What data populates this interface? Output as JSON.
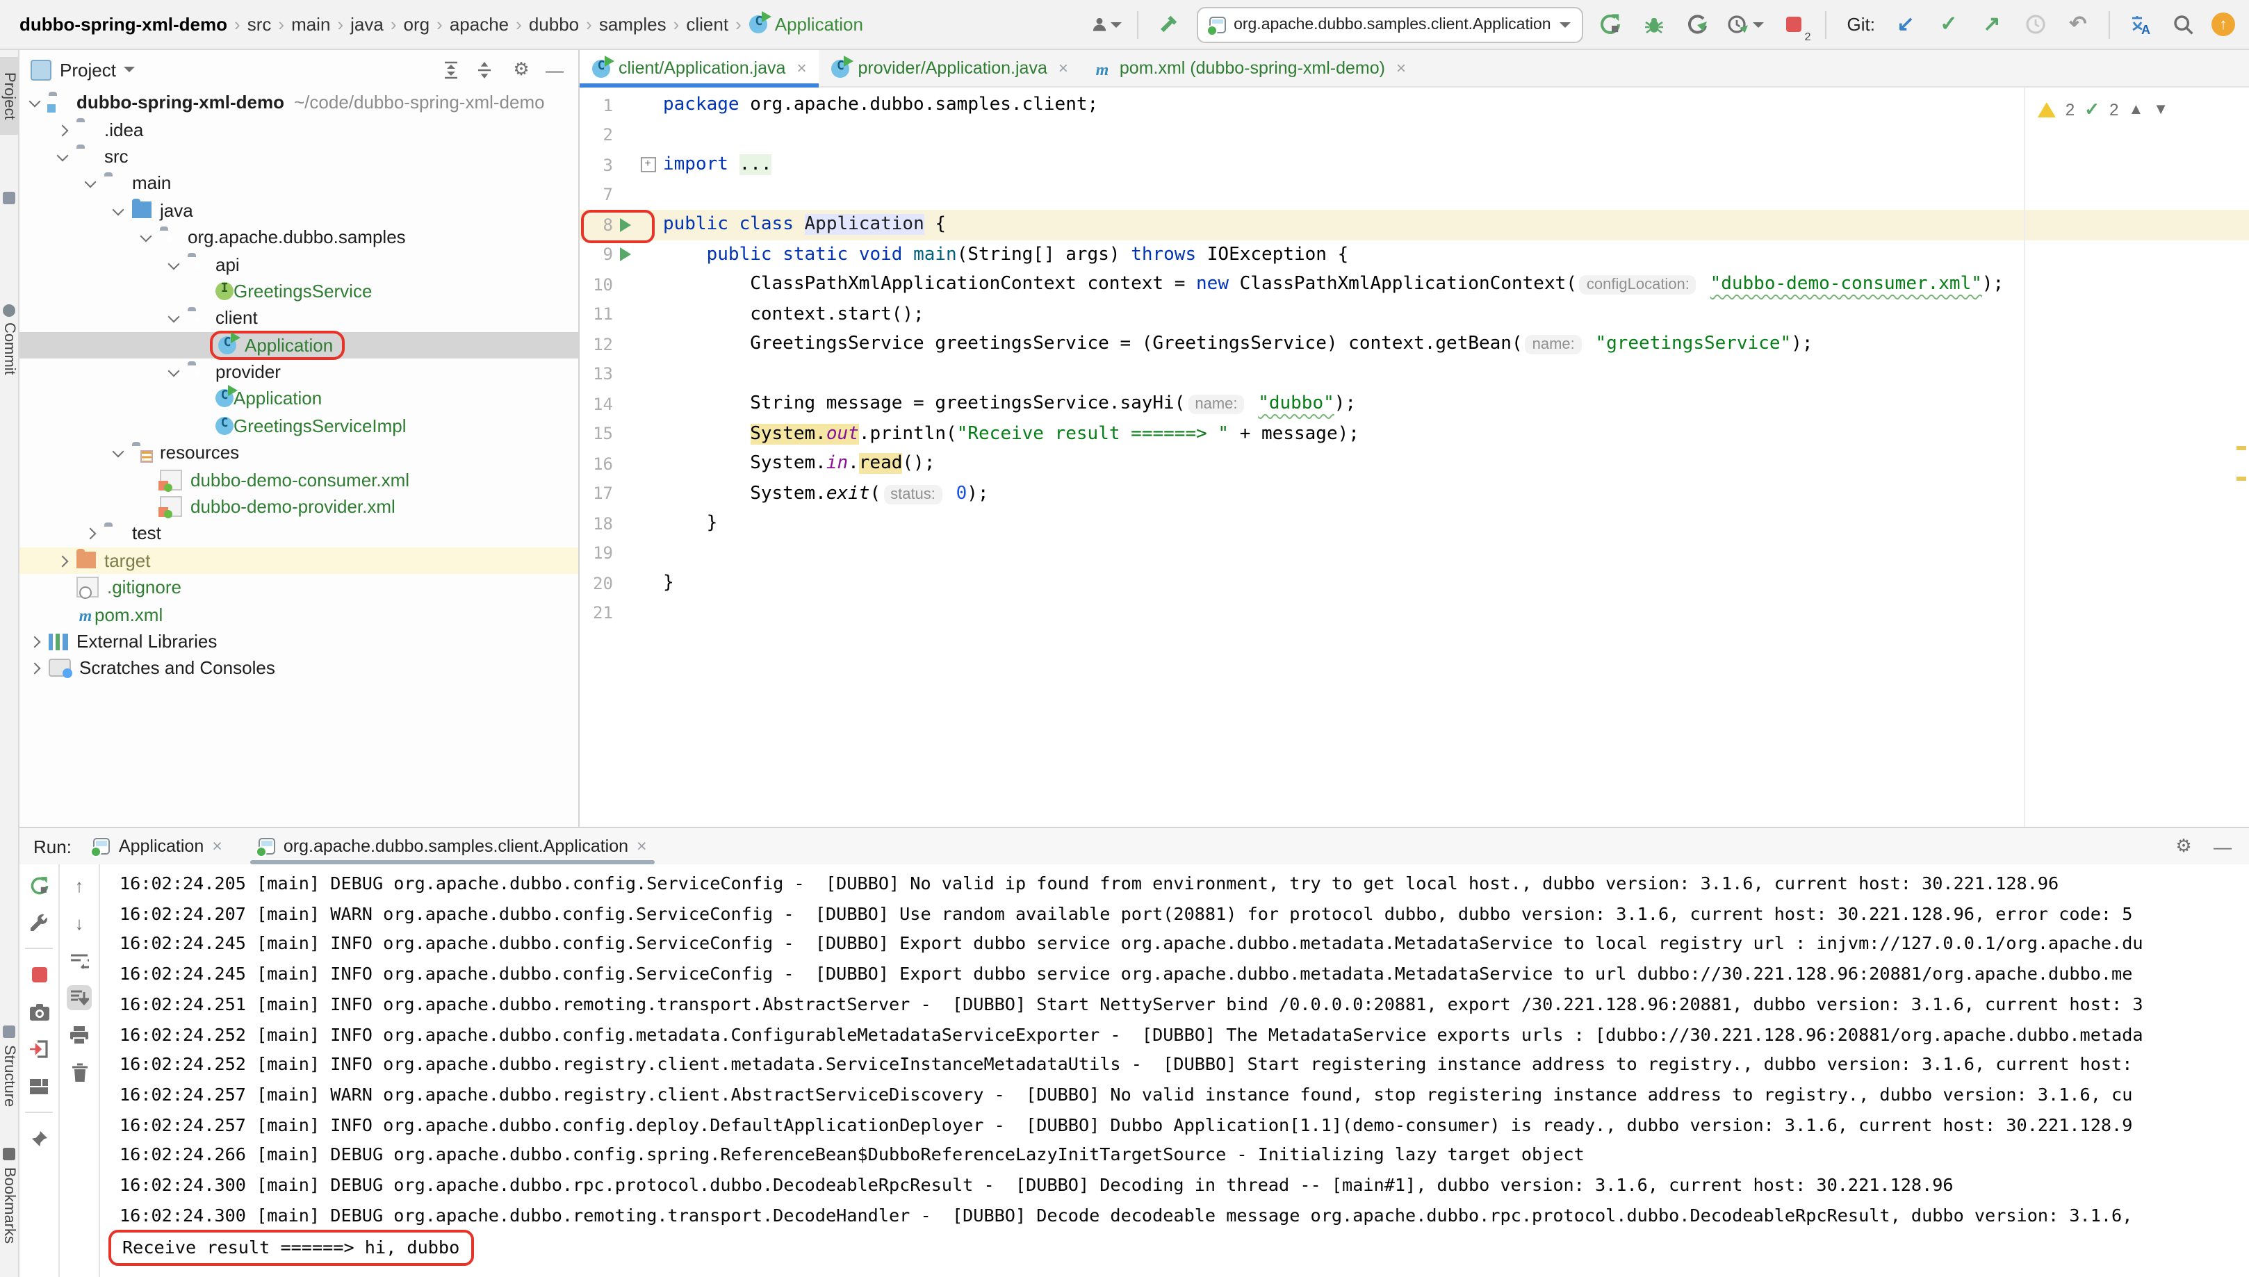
{
  "titlebar": {
    "breadcrumbs": [
      "dubbo-spring-xml-demo",
      "src",
      "main",
      "java",
      "org",
      "apache",
      "dubbo",
      "samples",
      "client",
      "Application"
    ],
    "run_config": "org.apache.dubbo.samples.client.Application",
    "git_label": "Git:",
    "stop_count": "2"
  },
  "editor_tabs": [
    {
      "label": "client/Application.java",
      "icon": "class-run",
      "active": true
    },
    {
      "label": "provider/Application.java",
      "icon": "class-run",
      "active": false
    },
    {
      "label": "pom.xml (dubbo-spring-xml-demo)",
      "icon": "maven",
      "active": false
    }
  ],
  "rail": {
    "project": "Project",
    "commit": "Commit",
    "structure": "Structure",
    "bookmarks": "Bookmarks"
  },
  "project": {
    "title": "Project",
    "tree": [
      {
        "label": "dubbo-spring-xml-demo",
        "hint": "~/code/dubbo-spring-xml-demo",
        "level": 0,
        "chev": "open",
        "icon": "f-proj",
        "bold": true
      },
      {
        "label": ".idea",
        "level": 1,
        "chev": "closed",
        "icon": "f"
      },
      {
        "label": "src",
        "level": 1,
        "chev": "open",
        "icon": "f"
      },
      {
        "label": "main",
        "level": 2,
        "chev": "open",
        "icon": "f"
      },
      {
        "label": "java",
        "level": 3,
        "chev": "open",
        "icon": "f-src"
      },
      {
        "label": "org.apache.dubbo.samples",
        "level": 4,
        "chev": "open",
        "icon": "f-pkg"
      },
      {
        "label": "api",
        "level": 5,
        "chev": "open",
        "icon": "f-pkg"
      },
      {
        "label": "GreetingsService",
        "level": 6,
        "icon": "interface",
        "green": true
      },
      {
        "label": "client",
        "level": 5,
        "chev": "open",
        "icon": "f-pkg"
      },
      {
        "label": "Application",
        "level": 6,
        "icon": "class-run",
        "green": true,
        "selected": true,
        "annotated": true
      },
      {
        "label": "provider",
        "level": 5,
        "chev": "open",
        "icon": "f-pkg"
      },
      {
        "label": "Application",
        "level": 6,
        "icon": "class-run",
        "green": true
      },
      {
        "label": "GreetingsServiceImpl",
        "level": 6,
        "icon": "class",
        "green": true
      },
      {
        "label": "resources",
        "level": 3,
        "chev": "open",
        "icon": "f-res"
      },
      {
        "label": "dubbo-demo-consumer.xml",
        "level": 4,
        "icon": "springxml",
        "green": true
      },
      {
        "label": "dubbo-demo-provider.xml",
        "level": 4,
        "icon": "springxml",
        "green": true
      },
      {
        "label": "test",
        "level": 2,
        "chev": "closed",
        "icon": "f"
      },
      {
        "label": "target",
        "level": 1,
        "chev": "closed",
        "icon": "f-excl",
        "olive": true,
        "rowhl": true
      },
      {
        "label": ".gitignore",
        "level": 1,
        "icon": "ignored",
        "green": true
      },
      {
        "label": "pom.xml",
        "level": 1,
        "icon": "maven",
        "green": true
      },
      {
        "label": "External Libraries",
        "level": 0,
        "chev": "closed",
        "icon": "libs"
      },
      {
        "label": "Scratches and Consoles",
        "level": 0,
        "chev": "closed",
        "icon": "scratch"
      }
    ]
  },
  "editor": {
    "inspections": {
      "warnings": "2",
      "ok": "2"
    },
    "lines": [
      {
        "n": "1",
        "t": [
          [
            "k",
            "package"
          ],
          [
            "p",
            " org.apache.dubbo.samples.client;"
          ]
        ]
      },
      {
        "n": "2",
        "t": []
      },
      {
        "n": "3",
        "fold": "plus",
        "t": [
          [
            "k",
            "import"
          ],
          [
            "p",
            " "
          ],
          [
            "fold",
            "..."
          ]
        ]
      },
      {
        "n": "7",
        "t": []
      },
      {
        "n": "8",
        "cur": true,
        "run": "box",
        "t": [
          [
            "k",
            "public"
          ],
          [
            "p",
            " "
          ],
          [
            "k",
            "class"
          ],
          [
            "p",
            " "
          ],
          [
            "caret",
            ""
          ],
          [
            "w",
            "Application"
          ],
          [
            "p",
            " {"
          ]
        ]
      },
      {
        "n": "9",
        "run": "plain",
        "t": [
          [
            "p",
            "    "
          ],
          [
            "k",
            "public"
          ],
          [
            "p",
            " "
          ],
          [
            "k",
            "static"
          ],
          [
            "p",
            " "
          ],
          [
            "k",
            "void"
          ],
          [
            "p",
            " "
          ],
          [
            "m",
            "main"
          ],
          [
            "p",
            "(String[] args) "
          ],
          [
            "k",
            "throws"
          ],
          [
            "p",
            " IOException {"
          ]
        ]
      },
      {
        "n": "10",
        "t": [
          [
            "p",
            "        ClassPathXmlApplicationContext context = "
          ],
          [
            "k",
            "new"
          ],
          [
            "p",
            " ClassPathXmlApplicationContext("
          ],
          [
            "inlay",
            "configLocation:"
          ],
          [
            "p",
            " "
          ],
          [
            "sw",
            "\"dubbo-demo-consumer.xml\""
          ],
          [
            "p",
            ");"
          ]
        ]
      },
      {
        "n": "11",
        "t": [
          [
            "p",
            "        context.start();"
          ]
        ]
      },
      {
        "n": "12",
        "t": [
          [
            "p",
            "        GreetingsService greetingsService = (GreetingsService) context.getBean("
          ],
          [
            "inlay",
            "name:"
          ],
          [
            "p",
            " "
          ],
          [
            "s",
            "\"greetingsService\""
          ],
          [
            "p",
            ");"
          ]
        ]
      },
      {
        "n": "13",
        "t": []
      },
      {
        "n": "14",
        "t": [
          [
            "p",
            "        String message = greetingsService.sayHi("
          ],
          [
            "inlay",
            "name:"
          ],
          [
            "p",
            " "
          ],
          [
            "sw",
            "\"dubbo\""
          ],
          [
            "p",
            ");"
          ]
        ]
      },
      {
        "n": "15",
        "t": [
          [
            "p",
            "        "
          ],
          [
            "p u",
            "System."
          ],
          [
            "f u",
            "out"
          ],
          [
            "p",
            ".println("
          ],
          [
            "s",
            "\"Receive result ======> \""
          ],
          [
            "p",
            " + message);"
          ]
        ]
      },
      {
        "n": "16",
        "t": [
          [
            "p",
            "        System."
          ],
          [
            "f",
            "in"
          ],
          [
            "p",
            "."
          ],
          [
            "p u",
            "read"
          ],
          [
            "p",
            "();"
          ]
        ]
      },
      {
        "n": "17",
        "t": [
          [
            "p",
            "        System."
          ],
          [
            "it",
            "exit"
          ],
          [
            "p",
            "("
          ],
          [
            "inlay",
            "status:"
          ],
          [
            "p",
            " "
          ],
          [
            "n0",
            "0"
          ],
          [
            "p",
            ");"
          ]
        ]
      },
      {
        "n": "18",
        "t": [
          [
            "p",
            "    }"
          ]
        ]
      },
      {
        "n": "19",
        "t": []
      },
      {
        "n": "20",
        "t": [
          [
            "p",
            "}"
          ]
        ]
      },
      {
        "n": "21",
        "t": []
      }
    ]
  },
  "run": {
    "label": "Run:",
    "tabs": [
      {
        "label": "Application",
        "active": false
      },
      {
        "label": "org.apache.dubbo.samples.client.Application",
        "active": true
      }
    ],
    "logs": [
      "16:02:24.205 [main] DEBUG org.apache.dubbo.config.ServiceConfig -  [DUBBO] No valid ip found from environment, try to get local host., dubbo version: 3.1.6, current host: 30.221.128.96",
      "16:02:24.207 [main] WARN org.apache.dubbo.config.ServiceConfig -  [DUBBO] Use random available port(20881) for protocol dubbo, dubbo version: 3.1.6, current host: 30.221.128.96, error code: 5",
      "16:02:24.245 [main] INFO org.apache.dubbo.config.ServiceConfig -  [DUBBO] Export dubbo service org.apache.dubbo.metadata.MetadataService to local registry url : injvm://127.0.0.1/org.apache.du",
      "16:02:24.245 [main] INFO org.apache.dubbo.config.ServiceConfig -  [DUBBO] Export dubbo service org.apache.dubbo.metadata.MetadataService to url dubbo://30.221.128.96:20881/org.apache.dubbo.me",
      "16:02:24.251 [main] INFO org.apache.dubbo.remoting.transport.AbstractServer -  [DUBBO] Start NettyServer bind /0.0.0.0:20881, export /30.221.128.96:20881, dubbo version: 3.1.6, current host: 3",
      "16:02:24.252 [main] INFO org.apache.dubbo.config.metadata.ConfigurableMetadataServiceExporter -  [DUBBO] The MetadataService exports urls : [dubbo://30.221.128.96:20881/org.apache.dubbo.metada",
      "16:02:24.252 [main] INFO org.apache.dubbo.registry.client.metadata.ServiceInstanceMetadataUtils -  [DUBBO] Start registering instance address to registry., dubbo version: 3.1.6, current host:",
      "16:02:24.257 [main] WARN org.apache.dubbo.registry.client.AbstractServiceDiscovery -  [DUBBO] No valid instance found, stop registering instance address to registry., dubbo version: 3.1.6, cu",
      "16:02:24.257 [main] INFO org.apache.dubbo.config.deploy.DefaultApplicationDeployer -  [DUBBO] Dubbo Application[1.1](demo-consumer) is ready., dubbo version: 3.1.6, current host: 30.221.128.9",
      "16:02:24.266 [main] DEBUG org.apache.dubbo.config.spring.ReferenceBean$DubboReferenceLazyInitTargetSource - Initializing lazy target object",
      "16:02:24.300 [main] DEBUG org.apache.dubbo.rpc.protocol.dubbo.DecodeableRpcResult -  [DUBBO] Decoding in thread -- [main#1], dubbo version: 3.1.6, current host: 30.221.128.96",
      "16:02:24.300 [main] DEBUG org.apache.dubbo.remoting.transport.DecodeHandler -  [DUBBO] Decode decodeable message org.apache.dubbo.rpc.protocol.dubbo.DecodeableRpcResult, dubbo version: 3.1.6, "
    ],
    "result": "Receive result ======> hi, dubbo"
  }
}
